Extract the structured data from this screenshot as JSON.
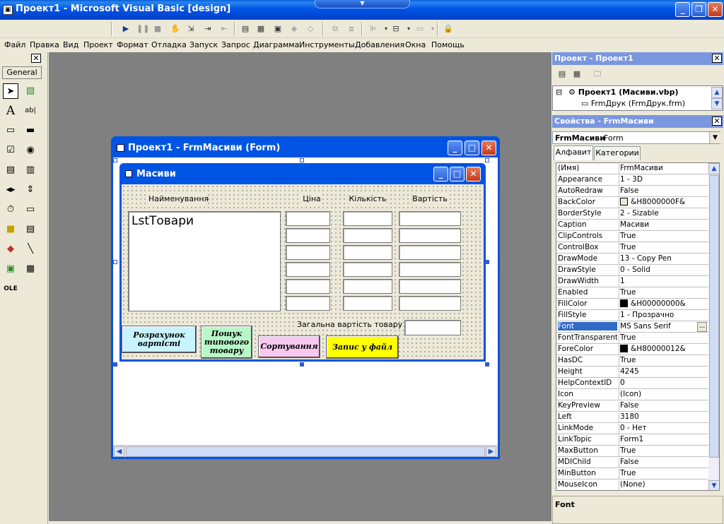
{
  "window": {
    "title": "Проект1 - Microsoft Visual Basic [design]"
  },
  "menu": [
    "Файл",
    "Правка",
    "Вид",
    "Проект",
    "Формат",
    "Отладка",
    "Запуск",
    "Запрос",
    "Диаграмма",
    "Инструменты",
    "Добавления",
    "Окна",
    "Помощь"
  ],
  "toolbox": {
    "tab": "General"
  },
  "outer_form": {
    "title": "Проект1 - FrmМасиви (Form)"
  },
  "inner_form": {
    "title": "Масиви",
    "labels": {
      "name": "Найменування",
      "price": "Ціна",
      "qty": "Кількість",
      "cost": "Вартість",
      "total": "Загальна вартість товару"
    },
    "listbox": "LstТовари",
    "buttons": {
      "calc": "Розрахунок вартісті",
      "search": "Пошук типового товару",
      "sort": "Сортування",
      "save": "Запис у файл"
    }
  },
  "project_panel": {
    "title": "Проект - Проект1",
    "root": "Проект1 (Масиви.vbp)",
    "child": "FrmДрук (FrmДрук.frm)"
  },
  "properties_panel": {
    "title": "Свойства - FrmМасиви",
    "object": "FrmМасиви",
    "object_type": "Form",
    "tabs": [
      "Алфавит",
      "Категории"
    ],
    "rows": [
      {
        "name": "(Имя)",
        "value": "FrmМасиви"
      },
      {
        "name": "Appearance",
        "value": "1 - 3D"
      },
      {
        "name": "AutoRedraw",
        "value": "False"
      },
      {
        "name": "BackColor",
        "value": "&H8000000F&",
        "swatch": "#ece9d8"
      },
      {
        "name": "BorderStyle",
        "value": "2 - Sizable"
      },
      {
        "name": "Caption",
        "value": "Масиви"
      },
      {
        "name": "ClipControls",
        "value": "True"
      },
      {
        "name": "ControlBox",
        "value": "True"
      },
      {
        "name": "DrawMode",
        "value": "13 - Copy Pen"
      },
      {
        "name": "DrawStyle",
        "value": "0 - Solid"
      },
      {
        "name": "DrawWidth",
        "value": "1"
      },
      {
        "name": "Enabled",
        "value": "True"
      },
      {
        "name": "FillColor",
        "value": "&H00000000&",
        "swatch": "#000000"
      },
      {
        "name": "FillStyle",
        "value": "1 - Прозрачно"
      },
      {
        "name": "Font",
        "value": "MS Sans Serif",
        "selected": true
      },
      {
        "name": "FontTransparent",
        "value": "True"
      },
      {
        "name": "ForeColor",
        "value": "&H80000012&",
        "swatch": "#000000"
      },
      {
        "name": "HasDC",
        "value": "True"
      },
      {
        "name": "Height",
        "value": "4245"
      },
      {
        "name": "HelpContextID",
        "value": "0"
      },
      {
        "name": "Icon",
        "value": "(Icon)"
      },
      {
        "name": "KeyPreview",
        "value": "False"
      },
      {
        "name": "Left",
        "value": "3180"
      },
      {
        "name": "LinkMode",
        "value": "0 - Нет"
      },
      {
        "name": "LinkTopic",
        "value": "Form1"
      },
      {
        "name": "MaxButton",
        "value": "True"
      },
      {
        "name": "MDIChild",
        "value": "False"
      },
      {
        "name": "MinButton",
        "value": "True"
      },
      {
        "name": "MouseIcon",
        "value": "(None)"
      }
    ],
    "description": "Font"
  }
}
